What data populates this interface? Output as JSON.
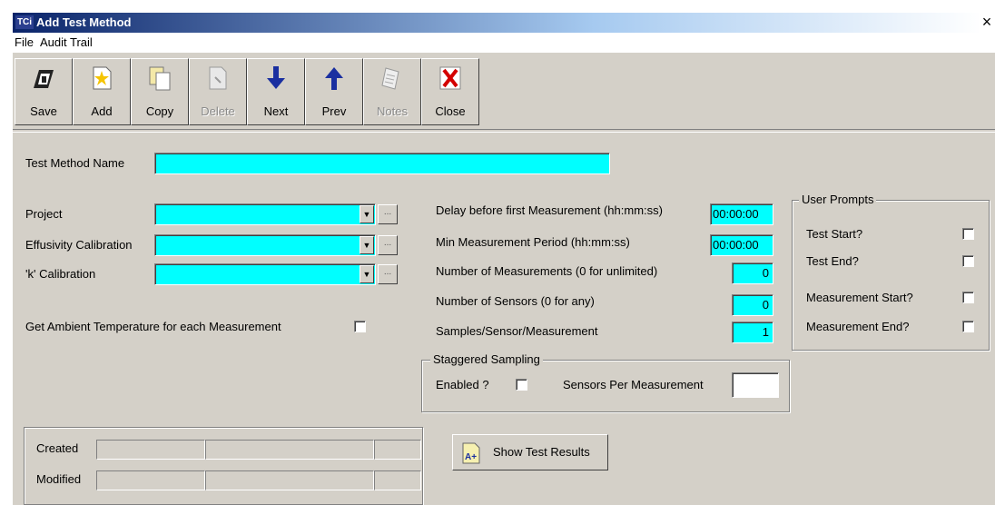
{
  "window": {
    "title": "Add Test Method",
    "logo": "TCi"
  },
  "menu": [
    "File",
    "Audit Trail"
  ],
  "toolbar": [
    {
      "label": "Save",
      "icon": "save-icon",
      "enabled": true
    },
    {
      "label": "Add",
      "icon": "add-icon",
      "enabled": true
    },
    {
      "label": "Copy",
      "icon": "copy-icon",
      "enabled": true
    },
    {
      "label": "Delete",
      "icon": "delete-icon",
      "enabled": false
    },
    {
      "label": "Next",
      "icon": "next-arrow-icon",
      "enabled": true
    },
    {
      "label": "Prev",
      "icon": "prev-arrow-icon",
      "enabled": true
    },
    {
      "label": "Notes",
      "icon": "notes-icon",
      "enabled": false
    },
    {
      "label": "Close",
      "icon": "close-icon",
      "enabled": true
    }
  ],
  "form": {
    "test_method_name_label": "Test Method Name",
    "test_method_name_value": "",
    "project_label": "Project",
    "effusivity_label": "Effusivity Calibration",
    "k_label": "'k' Calibration",
    "ellipsis": "...",
    "ambient_label": "Get Ambient Temperature for each Measurement",
    "delay_label": "Delay before first Measurement (hh:mm:ss)",
    "delay_value": "00:00:00",
    "min_period_label": "Min Measurement Period (hh:mm:ss)",
    "min_period_value": "00:00:00",
    "num_measurements_label": "Number of Measurements (0 for unlimited)",
    "num_measurements_value": "0",
    "num_sensors_label": "Number of Sensors (0 for any)",
    "num_sensors_value": "0",
    "samples_label": "Samples/Sensor/Measurement",
    "samples_value": "1"
  },
  "staggered": {
    "title": "Staggered Sampling",
    "enabled_label": "Enabled ?",
    "sensors_per_label": "Sensors Per Measurement"
  },
  "user_prompts": {
    "title": "User Prompts",
    "items": [
      "Test Start?",
      "Test End?",
      "Measurement Start?",
      "Measurement End?"
    ]
  },
  "audit": {
    "created_label": "Created",
    "modified_label": "Modified"
  },
  "show_results": {
    "label": "Show Test Results",
    "icon": "a-plus-icon"
  },
  "colors": {
    "field": "#00ffff",
    "face": "#d4d0c8",
    "title_start": "#0a246a"
  }
}
